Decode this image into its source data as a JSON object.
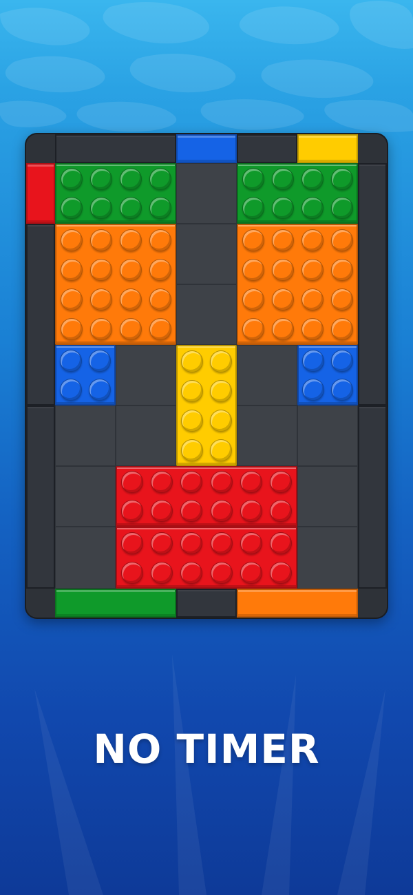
{
  "headline": "NO TIMER",
  "colors": {
    "red": "#e8141c",
    "green": "#0f9a2a",
    "orange": "#ff7a0a",
    "blue": "#1563e6",
    "yellow": "#ffcc00",
    "dark": "#2b2f36"
  },
  "board": {
    "cols": 5,
    "rows": 7,
    "exit_gates": [
      {
        "side": "top",
        "color": "blue"
      },
      {
        "side": "top",
        "color": "yellow"
      },
      {
        "side": "left",
        "color": "red"
      },
      {
        "side": "bottom",
        "color": "green"
      },
      {
        "side": "bottom",
        "color": "orange"
      }
    ],
    "bricks": [
      {
        "color": "green",
        "studs": "4x2"
      },
      {
        "color": "green",
        "studs": "4x2"
      },
      {
        "color": "orange",
        "studs": "4x4"
      },
      {
        "color": "orange",
        "studs": "4x4"
      },
      {
        "color": "blue",
        "studs": "2x2"
      },
      {
        "color": "yellow",
        "studs": "2x4"
      },
      {
        "color": "blue",
        "studs": "2x2"
      },
      {
        "color": "red",
        "studs": "6x2"
      },
      {
        "color": "red",
        "studs": "6x2"
      }
    ]
  }
}
